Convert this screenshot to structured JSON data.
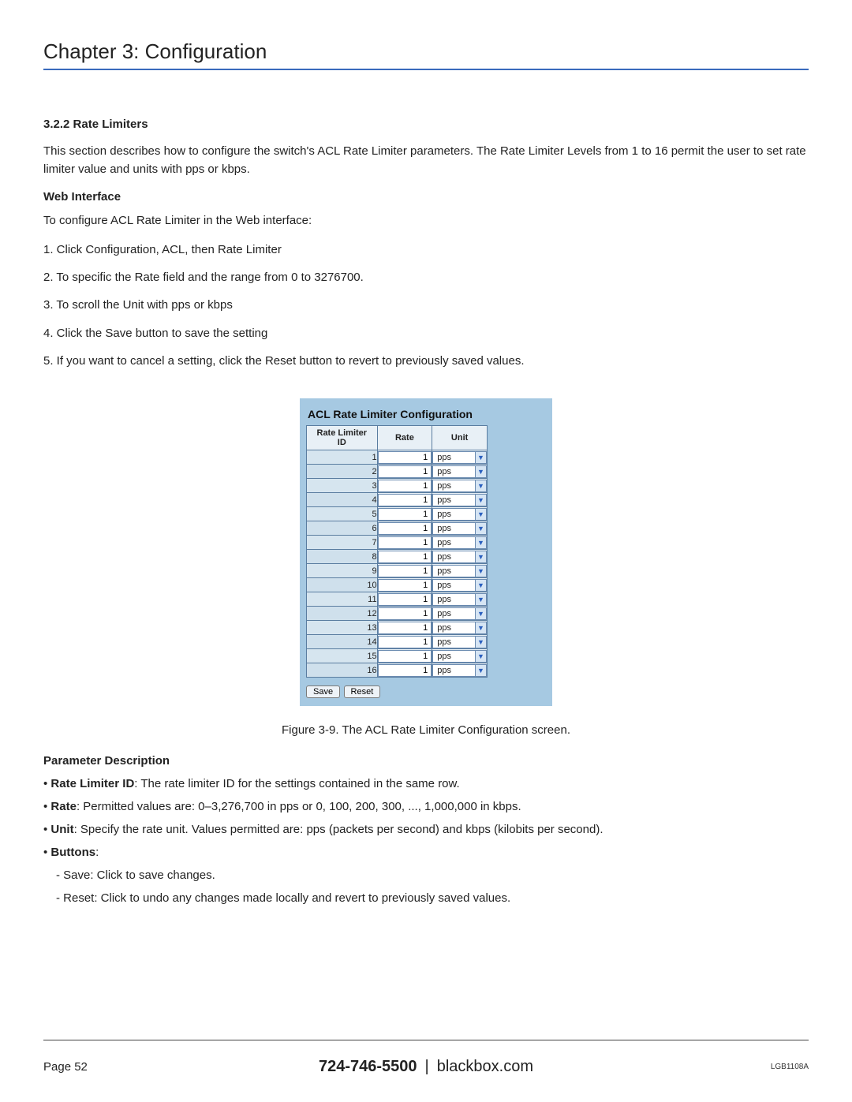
{
  "chapter_title": "Chapter 3: Configuration",
  "section_number_title": "3.2.2 Rate Limiters",
  "intro_paragraph": "This section describes how to configure the switch's ACL Rate Limiter parameters. The Rate Limiter Levels from 1 to 16 permit the user to set rate limiter value and units with pps or kbps.",
  "web_interface_heading": "Web Interface",
  "web_interface_intro": "To configure ACL Rate Limiter in the Web interface:",
  "steps": [
    "1. Click Configuration, ACL, then Rate Limiter",
    "2. To specific the Rate field and the range from 0 to 3276700.",
    "3. To scroll the Unit with pps or kbps",
    "4. Click the Save button to save the setting",
    "5. If you want to cancel a setting, click the Reset button to revert to previously saved values."
  ],
  "panel": {
    "title": "ACL Rate Limiter Configuration",
    "headers": {
      "id": "Rate Limiter ID",
      "rate": "Rate",
      "unit": "Unit"
    },
    "rows": [
      {
        "id": "1",
        "rate": "1",
        "unit": "pps"
      },
      {
        "id": "2",
        "rate": "1",
        "unit": "pps"
      },
      {
        "id": "3",
        "rate": "1",
        "unit": "pps"
      },
      {
        "id": "4",
        "rate": "1",
        "unit": "pps"
      },
      {
        "id": "5",
        "rate": "1",
        "unit": "pps"
      },
      {
        "id": "6",
        "rate": "1",
        "unit": "pps"
      },
      {
        "id": "7",
        "rate": "1",
        "unit": "pps"
      },
      {
        "id": "8",
        "rate": "1",
        "unit": "pps"
      },
      {
        "id": "9",
        "rate": "1",
        "unit": "pps"
      },
      {
        "id": "10",
        "rate": "1",
        "unit": "pps"
      },
      {
        "id": "11",
        "rate": "1",
        "unit": "pps"
      },
      {
        "id": "12",
        "rate": "1",
        "unit": "pps"
      },
      {
        "id": "13",
        "rate": "1",
        "unit": "pps"
      },
      {
        "id": "14",
        "rate": "1",
        "unit": "pps"
      },
      {
        "id": "15",
        "rate": "1",
        "unit": "pps"
      },
      {
        "id": "16",
        "rate": "1",
        "unit": "pps"
      }
    ],
    "buttons": {
      "save": "Save",
      "reset": "Reset"
    }
  },
  "figure_caption": "Figure 3-9. The ACL Rate Limiter Configuration screen.",
  "param_heading": "Parameter Description",
  "params": {
    "rate_limiter_id": {
      "name": "Rate Limiter ID",
      "desc": ": The rate limiter ID for the settings contained in the same row."
    },
    "rate": {
      "name": "Rate",
      "desc": ": Permitted values are: 0–3,276,700 in pps or 0, 100, 200, 300, ..., 1,000,000 in kbps."
    },
    "unit": {
      "name": "Unit",
      "desc": ": Specify the rate unit. Values permitted are: pps (packets per second) and kbps (kilobits per second)."
    },
    "buttons_label": "Buttons",
    "buttons_suffix": ":",
    "save_desc": "- Save: Click to save changes.",
    "reset_desc": "- Reset: Click to undo any changes made locally and revert to previously saved values."
  },
  "footer": {
    "page": "Page 52",
    "phone": "724-746-5500",
    "pipe": "|",
    "site": "blackbox.com",
    "model": "LGB1108A"
  }
}
